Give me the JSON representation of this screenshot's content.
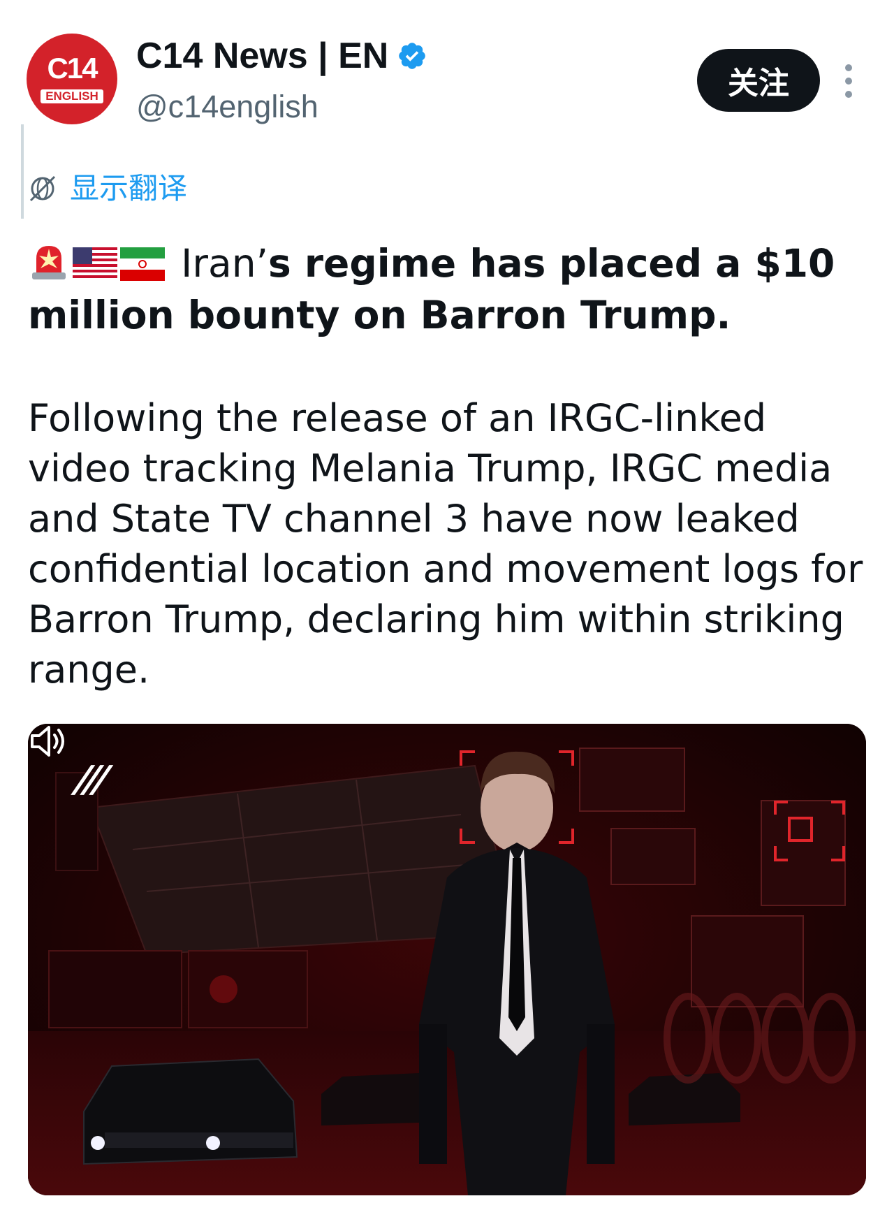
{
  "account": {
    "display_name": "C14 News | EN",
    "handle": "@c14english",
    "avatar_logo": "C14",
    "avatar_sub": "ENGLISH",
    "verified": true
  },
  "actions": {
    "follow_label": "关注",
    "translate_label": "显示翻译"
  },
  "post": {
    "headline_lead": "Iran’",
    "headline_rest": "s regime has placed a $10 million bounty on Barron Trump.",
    "body": "Following the release of an IRGC-linked video tracking Melania Trump, IRGC media and State TV channel 3  have now leaked confidential location and movement logs for Barron Trump, declaring him within striking range."
  },
  "media": {
    "logo_mark": "///",
    "icons": [
      "volume-icon"
    ]
  },
  "colors": {
    "link": "#1d9bf0",
    "brand_red": "#d3222a",
    "verified": "#1d9bf0",
    "text": "#0f1419",
    "muted": "#536471"
  }
}
